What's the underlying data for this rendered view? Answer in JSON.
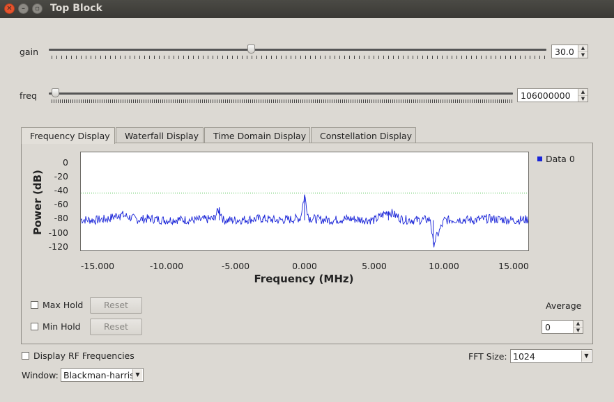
{
  "window": {
    "title": "Top Block"
  },
  "gain": {
    "label": "gain",
    "value": "30.0"
  },
  "freq": {
    "label": "freq",
    "value": "106000000"
  },
  "tabs": [
    {
      "label": "Frequency Display"
    },
    {
      "label": "Waterfall Display"
    },
    {
      "label": "Time Domain Display"
    },
    {
      "label": "Constellation Display"
    }
  ],
  "chart_data": {
    "type": "line",
    "xlabel": "Frequency (MHz)",
    "ylabel": "Power (dB)",
    "xlim": [
      -16,
      16
    ],
    "ylim": [
      -120,
      10
    ],
    "x_ticks": [
      "-15.000",
      "-10.000",
      "-5.000",
      "0.000",
      "5.000",
      "10.000",
      "15.000"
    ],
    "y_ticks": [
      "0",
      "-20",
      "-40",
      "-60",
      "-80",
      "-100",
      "-120"
    ],
    "threshold_line": -44,
    "series": [
      {
        "name": "Data 0",
        "color": "#1a25d8",
        "x": [
          -16.0,
          -15.0,
          -14.0,
          -13.2,
          -12.0,
          -11.0,
          -10.0,
          -9.0,
          -8.0,
          -7.0,
          -6.5,
          -6.1,
          -5.8,
          -5.0,
          -4.0,
          -3.0,
          -2.0,
          -1.0,
          -0.3,
          0.0,
          0.3,
          1.0,
          2.0,
          3.0,
          4.0,
          5.0,
          6.0,
          7.0,
          8.0,
          9.0,
          9.2,
          10.0,
          11.0,
          12.0,
          13.0,
          14.0,
          15.0,
          16.0
        ],
        "y": [
          -79,
          -80,
          -78,
          -72,
          -79,
          -78,
          -80,
          -79,
          -80,
          -79,
          -78,
          -65,
          -80,
          -80,
          -79,
          -78,
          -80,
          -79,
          -77,
          -47,
          -77,
          -79,
          -80,
          -78,
          -79,
          -80,
          -68,
          -79,
          -80,
          -79,
          -112,
          -80,
          -79,
          -80,
          -78,
          -79,
          -80,
          -79
        ]
      }
    ]
  },
  "legend": {
    "label": "Data 0"
  },
  "controls": {
    "max_hold": "Max Hold",
    "min_hold": "Min Hold",
    "reset": "Reset",
    "average_label": "Average",
    "average_value": "0",
    "display_rf": "Display RF Frequencies",
    "fft_label": "FFT Size:",
    "fft_value": "1024",
    "window_label": "Window:",
    "window_value": "Blackman-harris"
  }
}
